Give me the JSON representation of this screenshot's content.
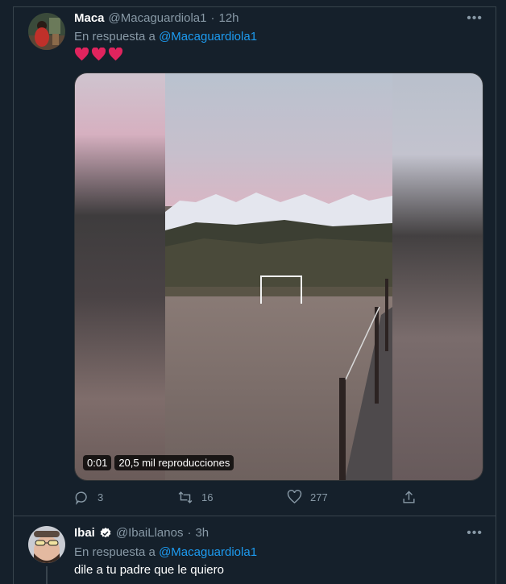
{
  "tweets": [
    {
      "author_name": "Maca",
      "handle": "@Macaguardiola1",
      "separator": "·",
      "time": "12h",
      "reply_prefix": "En respuesta a",
      "reply_to": "@Macaguardiola1",
      "text": "❤️❤️❤️",
      "video": {
        "duration": "0:01",
        "views": "20,5 mil reproducciones"
      },
      "stats": {
        "replies": "3",
        "retweets": "16",
        "likes": "277"
      }
    },
    {
      "author_name": "Ibai",
      "handle": "@IbaiLlanos",
      "separator": "·",
      "time": "3h",
      "verified": true,
      "reply_prefix": "En respuesta a",
      "reply_to": "@Macaguardiola1",
      "text": "dile a tu padre que le quiero"
    }
  ],
  "icons": {
    "more": "more-horizontal-icon",
    "reply": "reply-icon",
    "retweet": "retweet-icon",
    "like": "heart-icon",
    "share": "share-icon",
    "verified": "verified-badge-icon"
  },
  "colors": {
    "background": "#15202b",
    "border": "#38444d",
    "secondary_text": "#8899a6",
    "link": "#1d9bf0",
    "heart": "#e0245e"
  }
}
